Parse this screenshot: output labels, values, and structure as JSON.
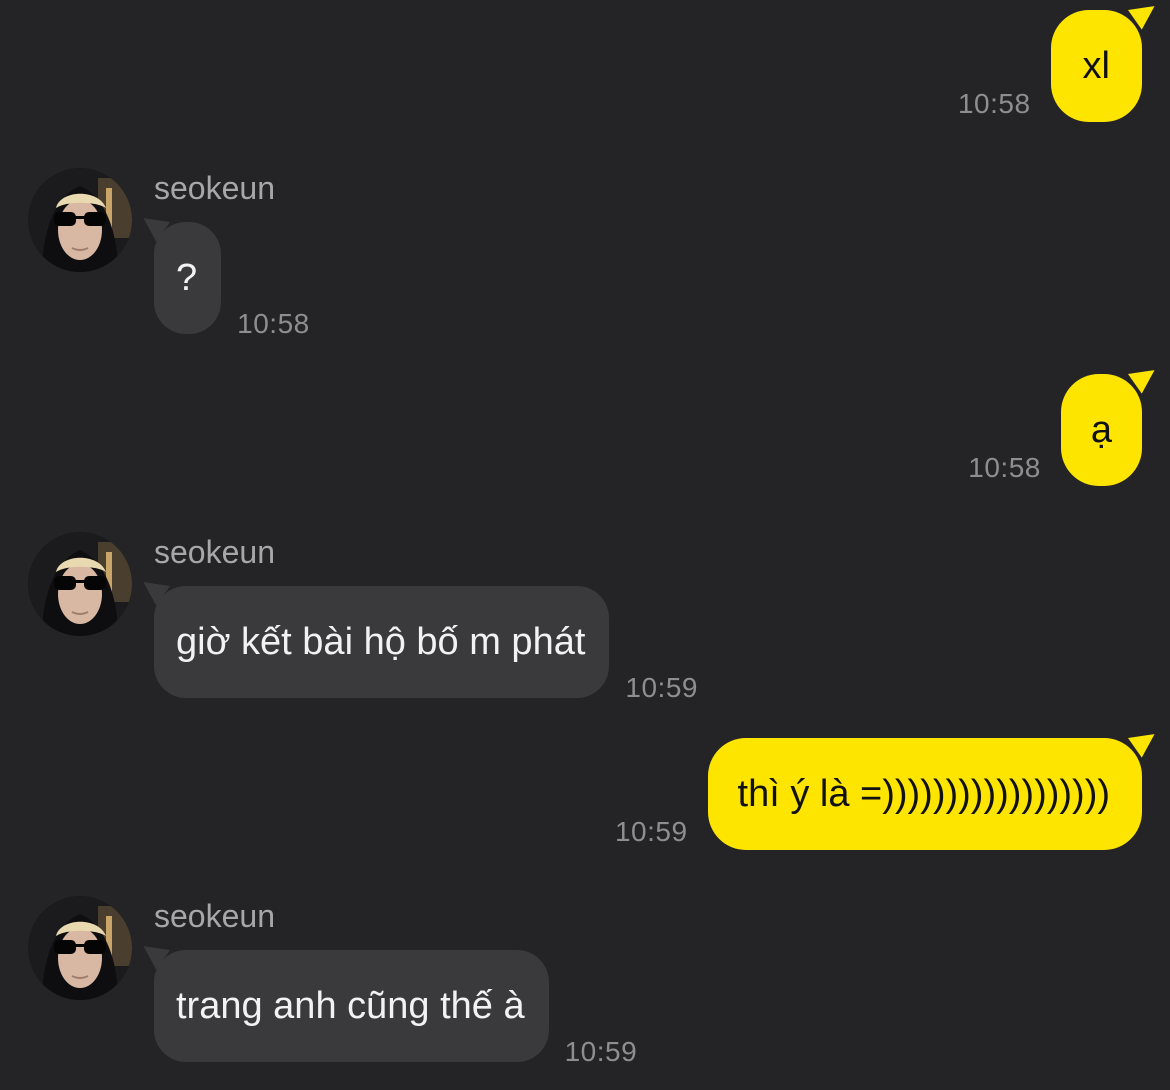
{
  "chat": {
    "messages": [
      {
        "direction": "sent",
        "text": "xl",
        "time": "10:58"
      },
      {
        "direction": "received",
        "sender": "seokeun",
        "text": "?",
        "time": "10:58"
      },
      {
        "direction": "sent",
        "text": "ạ",
        "time": "10:58"
      },
      {
        "direction": "received",
        "sender": "seokeun",
        "text": "giờ kết bài hộ bố m phát",
        "time": "10:59"
      },
      {
        "direction": "sent",
        "text": "thì ý là =))))))))))))))))))",
        "time": "10:59"
      },
      {
        "direction": "received",
        "sender": "seokeun",
        "text": "trang anh cũng thế à",
        "time": "10:59"
      }
    ]
  },
  "colors": {
    "background": "#242426",
    "sent_bubble": "#fee500",
    "received_bubble": "#3a3a3c",
    "timestamp": "#8e8e92",
    "sender_name": "#a7a7ab"
  }
}
